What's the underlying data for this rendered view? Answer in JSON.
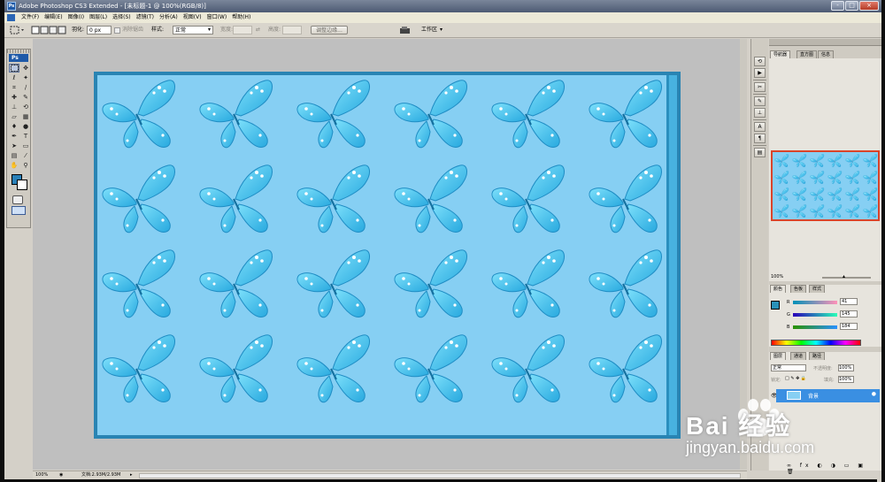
{
  "window": {
    "title": "Adobe Photoshop CS3 Extended - [未标题-1 @ 100%(RGB/8)]",
    "app_icon": "Ps",
    "buttons": [
      "-",
      "□",
      "×"
    ]
  },
  "menu": [
    "文件(F)",
    "编辑(E)",
    "图像(I)",
    "图层(L)",
    "选择(S)",
    "滤镜(T)",
    "分析(A)",
    "视图(V)",
    "窗口(W)",
    "帮助(H)"
  ],
  "options_bar": {
    "feather_label": "羽化:",
    "feather_value": "0 px",
    "antialias_label": "消除锯齿",
    "style_label": "样式:",
    "style_value": "正常",
    "width_label": "宽度:",
    "height_label": "高度:",
    "refine_edge_label": "调整边缘...",
    "workspace_label": "工作区"
  },
  "toolbox": {
    "logo": "Ps",
    "tools": [
      "marquee-icon",
      "move-icon",
      "lasso-icon",
      "magic-wand-icon",
      "crop-icon",
      "slice-icon",
      "healing-icon",
      "brush-icon",
      "stamp-icon",
      "history-brush-icon",
      "eraser-icon",
      "gradient-icon",
      "blur-icon",
      "dodge-icon",
      "pen-icon",
      "type-icon",
      "path-select-icon",
      "shape-icon",
      "notes-icon",
      "eyedropper-icon",
      "hand-icon",
      "zoom-icon"
    ],
    "foreground_color": "#2980b8",
    "background_color": "#ffffff"
  },
  "document": {
    "background": "#86cff3",
    "border_color": "#2984b3",
    "rows": 4,
    "cols": 6
  },
  "status": {
    "zoom": "100%",
    "doc_info": "文档:2.93M/2.93M"
  },
  "navigator": {
    "tabs": [
      "导航器",
      "直方图",
      "信息"
    ],
    "zoom": "100%"
  },
  "color_panel": {
    "tabs": [
      "颜色",
      "色板",
      "样式"
    ],
    "channels": [
      {
        "label": "R",
        "value": "41"
      },
      {
        "label": "G",
        "value": "145"
      },
      {
        "label": "B",
        "value": "184"
      }
    ],
    "swatch": "#2991b8"
  },
  "layers_panel": {
    "tabs": [
      "图层",
      "通道",
      "路径"
    ],
    "blend_mode": "正常",
    "opacity_label": "不透明度:",
    "opacity_value": "100%",
    "lock_label": "锁定:",
    "fill_label": "填充:",
    "fill_value": "100%",
    "layer_name": "背景"
  },
  "watermark": {
    "brand": "Bai 经验",
    "url": "jingyan.baidu.com"
  }
}
